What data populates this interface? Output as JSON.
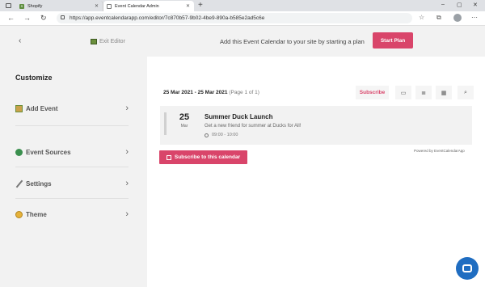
{
  "browser": {
    "tabs": [
      {
        "label": "Shopify",
        "active": false
      },
      {
        "label": "Event Calendar Admin",
        "active": true
      }
    ],
    "new_tab": "+",
    "url": "https://app.eventcalendarapp.com/editor/7c870b57-9b02-4be9-890a-b585e2ad5c6e",
    "window_controls": [
      "–",
      "▢",
      "✕"
    ],
    "toolbar_icons": [
      "star-icon",
      "collections-icon",
      "extensions-icon",
      "profile-icon",
      "more-icon"
    ]
  },
  "header": {
    "back": "‹",
    "exit_editor": "Exit Editor",
    "promo": "Add this Event Calendar to your site by starting a plan",
    "start_plan": "Start Plan"
  },
  "sidebar": {
    "title": "Customize",
    "items": [
      {
        "label": "Add Event",
        "icon": "image-icon"
      },
      {
        "label": "Event Sources",
        "icon": "globe-icon"
      },
      {
        "label": "Settings",
        "icon": "pencil-icon"
      },
      {
        "label": "Theme",
        "icon": "palette-icon"
      }
    ],
    "chevron": "›"
  },
  "main": {
    "date_range": "25 Mar 2021 - 25 Mar 2021",
    "page_info": "(Page 1 of 1)",
    "subscribe": "Subscribe",
    "view_buttons": [
      "calendar-view-icon",
      "list-view-icon",
      "grid-view-icon",
      "search-icon"
    ],
    "event": {
      "day": "25",
      "month": "Mar",
      "title": "Summer Duck Launch",
      "description": "Get a new friend for summer at Ducks for All!",
      "time": "09:00 - 10:00"
    },
    "powered_by": "Powered by EventCalendarApp",
    "subscribe_calendar": "Subscribe to this calendar"
  },
  "colors": {
    "accent": "#d9456a",
    "chat": "#1f6dc1"
  }
}
